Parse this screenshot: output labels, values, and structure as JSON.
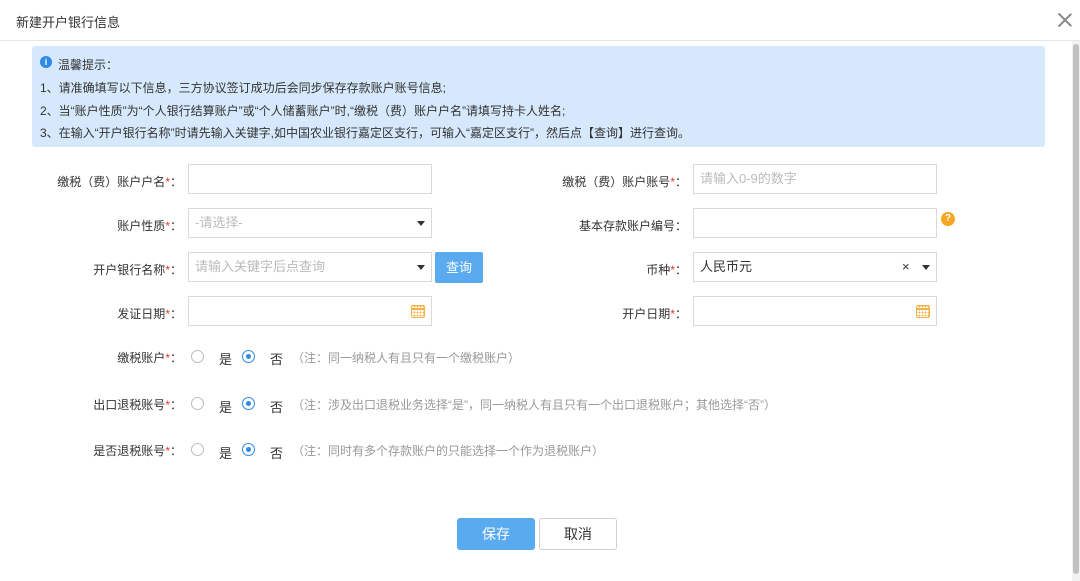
{
  "dialog": {
    "title": "新建开户银行信息"
  },
  "tips": {
    "heading": "温馨提示：",
    "lines": [
      "1、请准确填写以下信息，三方协议签订成功后会同步保存存款账户账号信息;",
      "2、当“账户性质”为“个人银行结算账户”或“个人储蓄账户”时,“缴税（费）账户户名”请填写持卡人姓名;",
      "3、在输入“开户银行名称”时请先输入关键字,如中国农业银行嘉定区支行，可输入“嘉定区支行”，然后点【查询】进行查询。"
    ]
  },
  "form": {
    "required_mark": "*",
    "colon": "：",
    "account_name": {
      "label": "缴税（费）账户户名",
      "value": ""
    },
    "account_number": {
      "label": "缴税（费）账户账号",
      "placeholder": "请输入0-9的数字"
    },
    "account_nature": {
      "label": "账户性质",
      "placeholder": "-请选择-"
    },
    "deposit_account_code": {
      "label": "基本存款账户编号",
      "value": ""
    },
    "bank_name": {
      "label": "开户银行名称",
      "placeholder": "请输入关键字后点查询",
      "query_button": "查询"
    },
    "currency": {
      "label": "币种",
      "value": "人民币元"
    },
    "issue_date": {
      "label": "发证日期",
      "value": ""
    },
    "open_date": {
      "label": "开户日期",
      "value": ""
    },
    "tax_account": {
      "label": "缴税账户",
      "yes": "是",
      "no": "否",
      "selected": "否",
      "note": "（注：同一纳税人有且只有一个缴税账户）"
    },
    "export_refund_account": {
      "label": "出口退税账号",
      "yes": "是",
      "no": "否",
      "selected": "否",
      "note": "（注：涉及出口退税业务选择“是”，同一纳税人有且只有一个出口退税账户；其他选择“否”）"
    },
    "refund_account": {
      "label": "是否退税账号",
      "yes": "是",
      "no": "否",
      "selected": "否",
      "note": "（注：同时有多个存款账户的只能选择一个作为退税账户）"
    }
  },
  "footer": {
    "save": "保存",
    "cancel": "取消"
  },
  "icons": {
    "info": "info-icon",
    "close": "close-icon",
    "calendar": "calendar-icon",
    "help": "question-icon",
    "dropdown": "chevron-down-icon",
    "clear": "clear-icon"
  },
  "colors": {
    "accent": "#5aaaf0",
    "tip_bg": "#d6e8fb",
    "required": "#e33333",
    "calendar": "#f0b24a",
    "help": "#f5a623"
  }
}
